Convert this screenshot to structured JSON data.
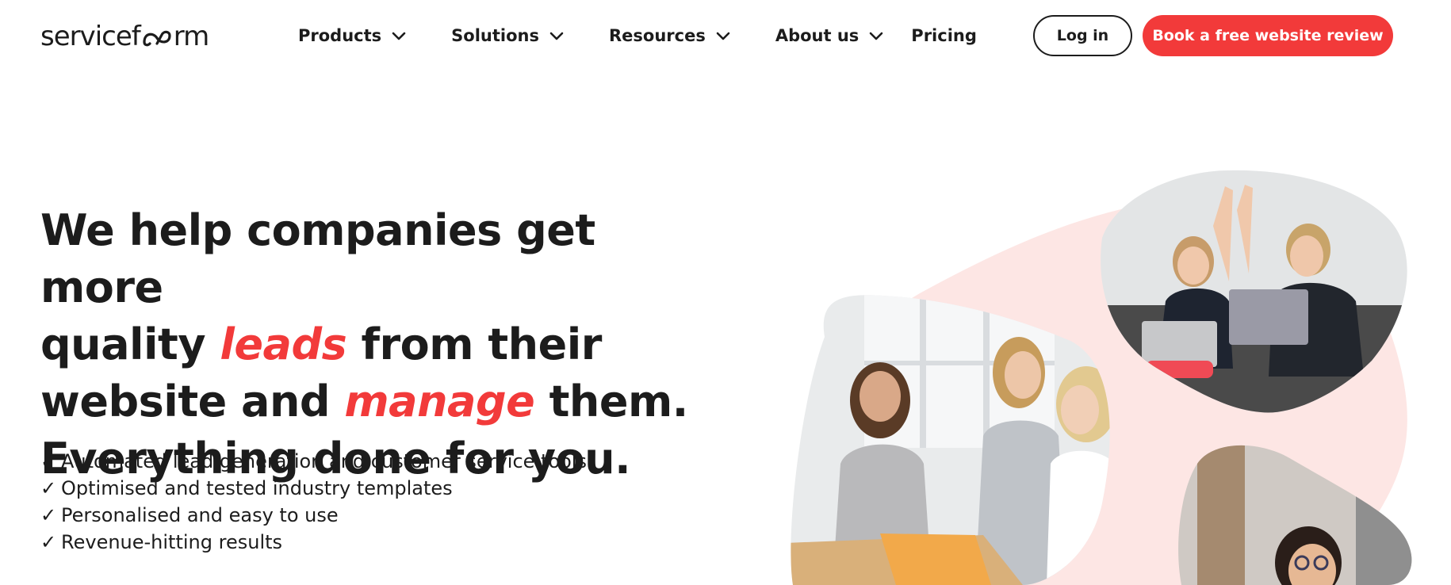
{
  "brand": {
    "logo_before": "servicef",
    "logo_after": "rm",
    "accent_color": "#f23a3a",
    "text_color": "#1c1c1c"
  },
  "nav": {
    "items": [
      {
        "label": "Products",
        "icon": "chevron-down-icon"
      },
      {
        "label": "Solutions",
        "icon": "chevron-down-icon"
      },
      {
        "label": "Resources",
        "icon": "chevron-down-icon"
      },
      {
        "label": "About us",
        "icon": "chevron-down-icon"
      },
      {
        "label": "Pricing"
      }
    ]
  },
  "header": {
    "login_label": "Log in",
    "cta_label": "Book a free website review"
  },
  "hero": {
    "line1": "We help companies get more",
    "line2_a": "quality ",
    "line2_accent": "leads",
    "line2_b": " from their",
    "line3_a": "website and ",
    "line3_accent": "manage",
    "line3_b": " them.",
    "line4": "Everything done for you.",
    "features": [
      "Automated lead generation and customer service tools",
      "Optimised and tested industry templates",
      "Personalised and easy to use",
      "Revenue-hitting results"
    ],
    "check_glyph": "✓"
  },
  "images": [
    {
      "name": "team-meeting-photo",
      "description_icon": "photo-icon"
    },
    {
      "name": "high-five-photo",
      "description_icon": "photo-icon"
    },
    {
      "name": "smiling-woman-photo",
      "description_icon": "photo-icon"
    }
  ]
}
